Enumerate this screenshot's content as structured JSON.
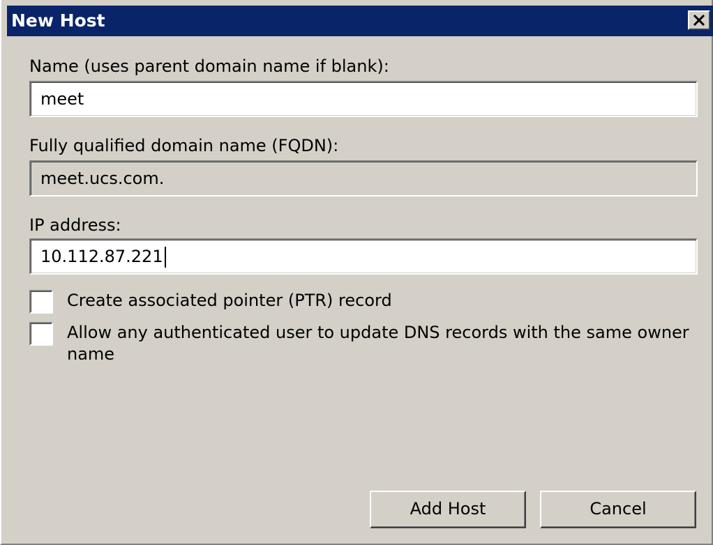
{
  "window": {
    "title": "New Host"
  },
  "form": {
    "name_label": "Name (uses parent domain name if blank):",
    "name_value": "meet",
    "fqdn_label": "Fully qualified domain name (FQDN):",
    "fqdn_value": "meet.ucs.com.",
    "ip_label": "IP address:",
    "ip_value": "10.112.87.221",
    "ptr_label": "Create associated pointer (PTR) record",
    "ptr_checked": false,
    "allow_update_label": "Allow any authenticated user to update DNS records with the same owner name",
    "allow_update_checked": false
  },
  "buttons": {
    "add_host": "Add Host",
    "cancel": "Cancel"
  },
  "colors": {
    "titlebar": "#0a246a",
    "dialog_face": "#d4d0c8"
  },
  "icons": {
    "close": "close-icon"
  }
}
